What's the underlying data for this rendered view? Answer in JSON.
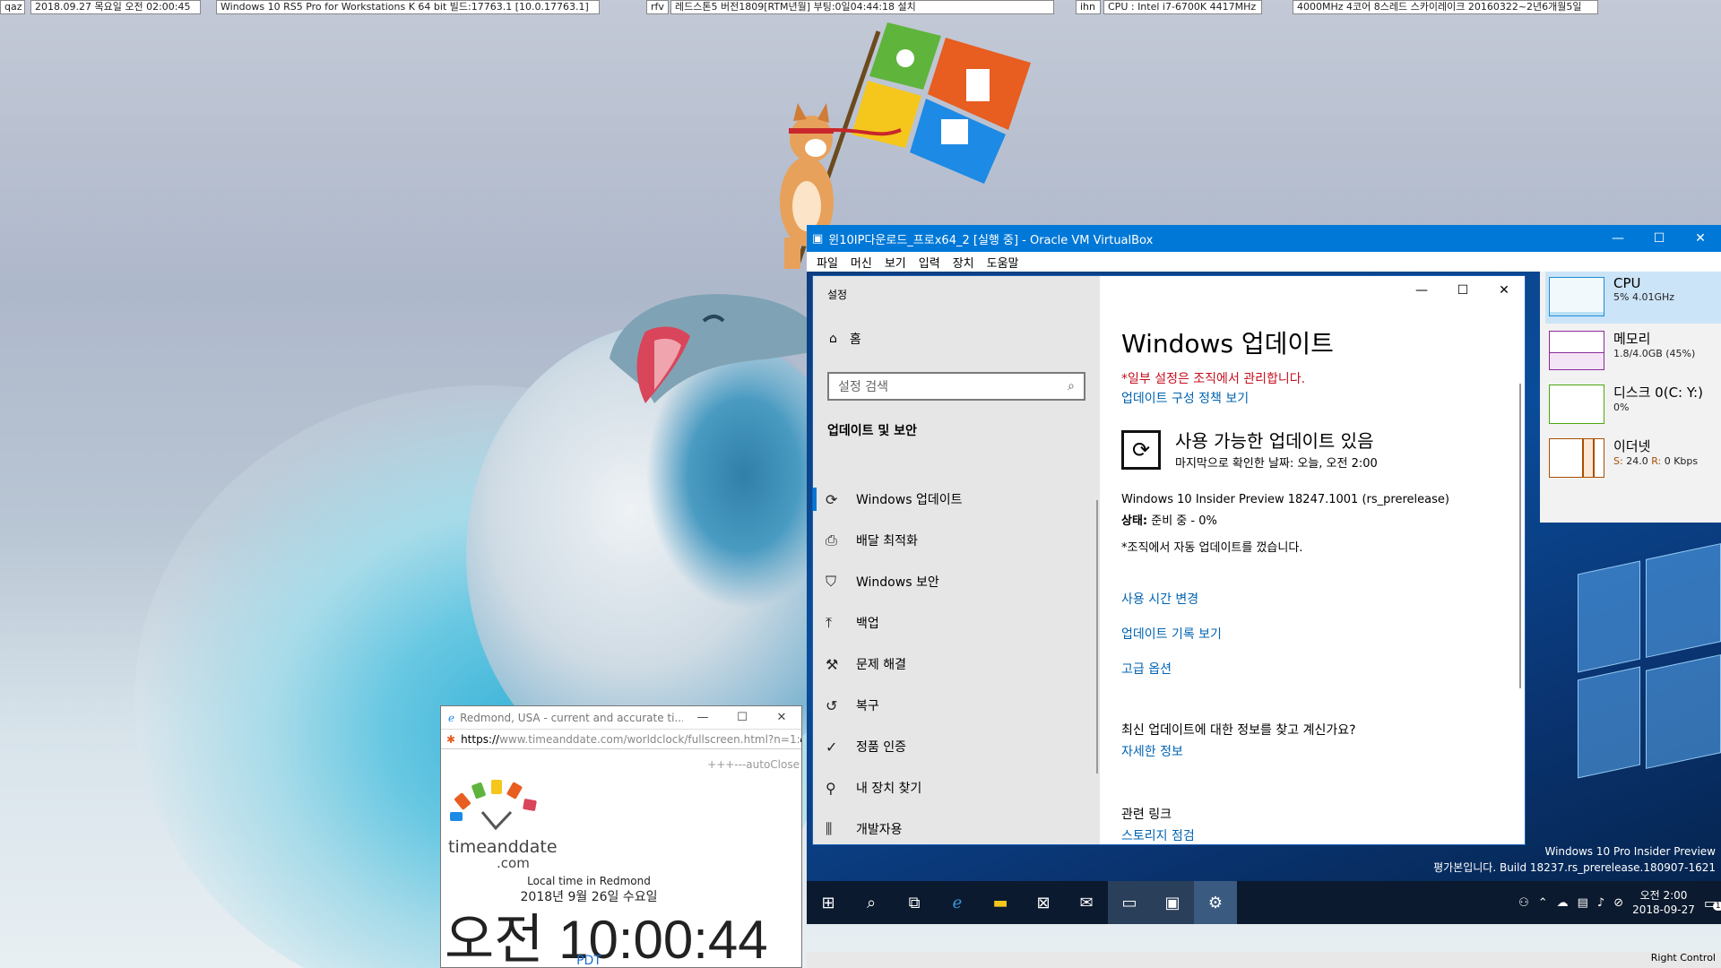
{
  "info_bar": [
    {
      "label": "qaz"
    },
    {
      "label": "2018.09.27 목요일 오전 02:00:45"
    },
    {
      "label": "Windows 10 RS5 Pro for Workstations K 64 bit 빌드:17763.1 [10.0.17763.1]"
    },
    {
      "label": "rfv"
    },
    {
      "label": "레드스톤5 버전1809[RTM년월] 부팅:0일04:44:18 설치"
    },
    {
      "label": "ihn"
    },
    {
      "label": "CPU : Intel i7-6700K 4417MHz"
    },
    {
      "label": "4000MHz 4코어 8스레드 스카이레이크 20160322~2년6개월5일"
    }
  ],
  "vbox": {
    "title": "윈10IP다운로드_프로x64_2 [실행 중] - Oracle VM VirtualBox",
    "menu": [
      "파일",
      "머신",
      "보기",
      "입력",
      "장치",
      "도움말"
    ],
    "status_text": "Right Control"
  },
  "settings": {
    "window_title": "설정",
    "home": "홈",
    "search_placeholder": "설정 검색",
    "section": "업데이트 및 보안",
    "nav": [
      {
        "label": "Windows 업데이트",
        "icon": "refresh-icon"
      },
      {
        "label": "배달 최적화",
        "icon": "delivery-icon"
      },
      {
        "label": "Windows 보안",
        "icon": "shield-icon"
      },
      {
        "label": "백업",
        "icon": "backup-icon"
      },
      {
        "label": "문제 해결",
        "icon": "wrench-icon"
      },
      {
        "label": "복구",
        "icon": "history-icon"
      },
      {
        "label": "정품 인증",
        "icon": "check-circle-icon"
      },
      {
        "label": "내 장치 찾기",
        "icon": "person-pin-icon"
      },
      {
        "label": "개발자용",
        "icon": "developer-icon"
      }
    ],
    "main_title": "Windows 업데이트",
    "warning": "*일부 설정은 조직에서 관리합니다.",
    "policy_link": "업데이트 구성 정책 보기",
    "update_heading": "사용 가능한 업데이트 있음",
    "last_checked": "마지막으로 확인한 날짜: 오늘, 오전 2:00",
    "update_name": "Windows 10 Insider Preview 18247.1001 (rs_prerelease)",
    "status_label": "상태:",
    "status_value": " 준비 중 - 0%",
    "org_note": "*조직에서 자동 업데이트를 껐습니다.",
    "links": [
      "사용 시간 변경",
      "업데이트 기록 보기",
      "고급 옵션"
    ],
    "info_question": "최신 업데이트에 대한 정보를 찾고 계신가요?",
    "info_link": "자세한 정보",
    "related_title": "관련 링크",
    "related_link": "스토리지 점검"
  },
  "perf": [
    {
      "name": "CPU",
      "value": "5% 4.01GHz",
      "color": "#1a8fd8",
      "level": 0.05
    },
    {
      "name": "메모리",
      "value": "1.8/4.0GB (45%)",
      "color": "#8b2a9e",
      "level": 0.45
    },
    {
      "name": "디스크 0(C: Y:)",
      "value": "0%",
      "color": "#4da60c",
      "level": 0.0
    },
    {
      "name": "이더넷",
      "value_s": "S:",
      "value_s_num": " 24.0 ",
      "value_r": "R:",
      "value_r_num": " 0 Kbps",
      "color": "#a74f01",
      "level": 0.1
    }
  ],
  "watermark": {
    "line1": "Windows 10 Pro Insider Preview",
    "line2": "평가본입니다. Build 18237.rs_prerelease.180907-1621"
  },
  "taskbar": {
    "icons": [
      "windows-start-icon",
      "search-icon",
      "task-view-icon",
      "edge-icon",
      "file-explorer-icon",
      "store-icon",
      "mail-icon",
      "terminal-icon",
      "virtualbox-icon",
      "settings-gear-icon"
    ],
    "clock_time": "오전 2:00",
    "clock_date": "2018-09-27",
    "notification_count": "1"
  },
  "ie": {
    "title": "Redmond, USA - current and accurate ti...",
    "url_scheme": "https://",
    "url_host": "www.timeanddate.com",
    "url_path": "/worldclock/fullscreen.html?n=1:",
    "autoclose": "+++---autoClose",
    "logo_text": "timeanddate",
    "logo_com": ".com",
    "local_label": "Local time in Redmond",
    "date": "2018년 9월 26일 수요일",
    "time": "오전 10:00:44",
    "tz": "PDT"
  }
}
